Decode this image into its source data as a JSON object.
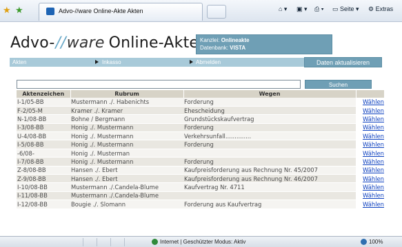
{
  "browser": {
    "tab_title": "Advo-//ware Online-Akte Akten",
    "tools": {
      "seite": "Seite",
      "extras": "Extras"
    }
  },
  "header": {
    "logo": {
      "part1": "Advo-",
      "slash": "//",
      "part2": "ware",
      "part3": "Online-Akte"
    },
    "kanzlei_label": "Kanzlei:",
    "kanzlei_value": "Onlineakte",
    "datenbank_label": "Datenbank:",
    "datenbank_value": "VISTA"
  },
  "nav": {
    "items": [
      "Akten",
      "Inkasso",
      "Abmelden"
    ],
    "refresh_label": "Daten aktualisieren"
  },
  "search": {
    "value": "",
    "button_label": "Suchen"
  },
  "table": {
    "headers": [
      "Aktenzeichen",
      "Rubrum",
      "Wegen",
      ""
    ],
    "link_label": "Wählen",
    "rows": [
      [
        "I-1/05-BB",
        "Mustermann ./. Habenichts",
        "Forderung"
      ],
      [
        "F-2/05-M",
        "Kramer ./. Kramer",
        "Ehescheidung"
      ],
      [
        "N-1/08-BB",
        "Bohne / Bergmann",
        "Grundstückskaufvertrag"
      ],
      [
        "I-3/08-BB",
        "Honig ./. Mustermann",
        "Forderung"
      ],
      [
        "U-4/08-BB",
        "Honig ./. Mustermann",
        "Verkehrsunfall.............."
      ],
      [
        "I-5/08-BB",
        "Honig ./. Mustermann",
        "Forderung"
      ],
      [
        "-6/08-",
        "Honig ./. Musterman",
        ""
      ],
      [
        "I-7/08-BB",
        "Honig ./. Mustermann",
        "Forderung"
      ],
      [
        "Z-8/08-BB",
        "Hansen ./. Ebert",
        "Kaufpreisforderung aus Rechnung Nr. 45/2007"
      ],
      [
        "Z-9/08-BB",
        "Hansen ./. Ebert",
        "Kaufpreisforderung aus Rechnung Nr. 46/2007"
      ],
      [
        "I-10/08-BB",
        "Mustermann ./.Candela-Blume",
        "Kaufvertrag Nr. 4711"
      ],
      [
        "I-11/08-BB",
        "Mustermann ./.Candela-Blume",
        ""
      ],
      [
        "I-12/08-BB",
        "Bougie ./. Slomann",
        "Forderung aus Kaufvertrag"
      ]
    ]
  },
  "status": {
    "zone": "Internet | Geschützter Modus: Aktiv",
    "zoom": "100%"
  },
  "colors": {
    "accent": "#6f9fb5",
    "nav_bg": "#a8cad9",
    "link": "#0b3fbf",
    "header_bg": "#d7d3c7"
  }
}
